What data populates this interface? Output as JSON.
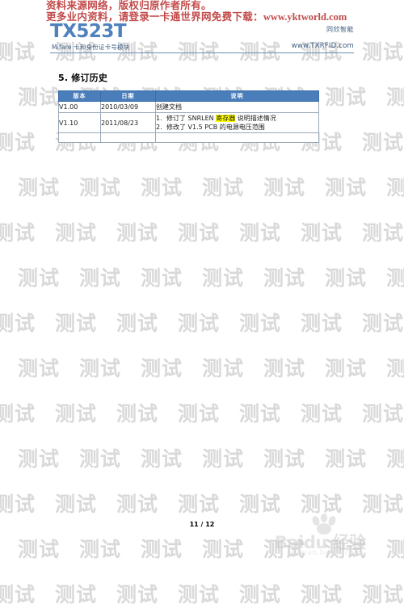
{
  "notice": {
    "line1": "资料来源网络，版权归原作者所有。",
    "line2_prefix": "更多业内资料，请登录一卡通世界网免费下载：",
    "line2_url": "www.yktworld.com"
  },
  "header": {
    "product_title": "TX523T",
    "product_subtitle": "Mifare 卡和身份证卡号模块",
    "company_name": "同欣智能",
    "company_url": "www.TXRFID.com",
    "accent_color": "#4f81bd"
  },
  "section": {
    "number": "5.",
    "title": "修订历史",
    "heading": "5. 修订历史"
  },
  "table": {
    "header_bg": "#4a7ebb",
    "columns": [
      "版本",
      "日期",
      "说明"
    ],
    "rows": [
      {
        "version": "V1.00",
        "date": "2010/03/09",
        "description_lines": [
          {
            "num": "",
            "text": "创建文档",
            "highlight": ""
          }
        ]
      },
      {
        "version": "V1.10",
        "date": "2011/08/23",
        "description_lines": [
          {
            "num": "1.",
            "text_before": "修订了 SNRLEN ",
            "highlight": "寄存器",
            "text_after": " 说明描述情况",
            "text": "修订了 SNRLEN 寄存器说明描述情况"
          },
          {
            "num": "2.",
            "text_before": "修改了 V1.5 PCB 的电源电压范围",
            "highlight": "",
            "text_after": "",
            "text": "修改了 V1.5 PCB 的电源电压范围"
          }
        ]
      },
      {
        "version": "",
        "date": "",
        "description_lines": []
      }
    ]
  },
  "footer": {
    "page_label": "11 / 12"
  },
  "watermarks": {
    "tile_text": "测试",
    "tile_color": "#d8d8d8",
    "baidu_text": "Baidu 经验",
    "baidu_url": "jingyan.baidu.com"
  }
}
